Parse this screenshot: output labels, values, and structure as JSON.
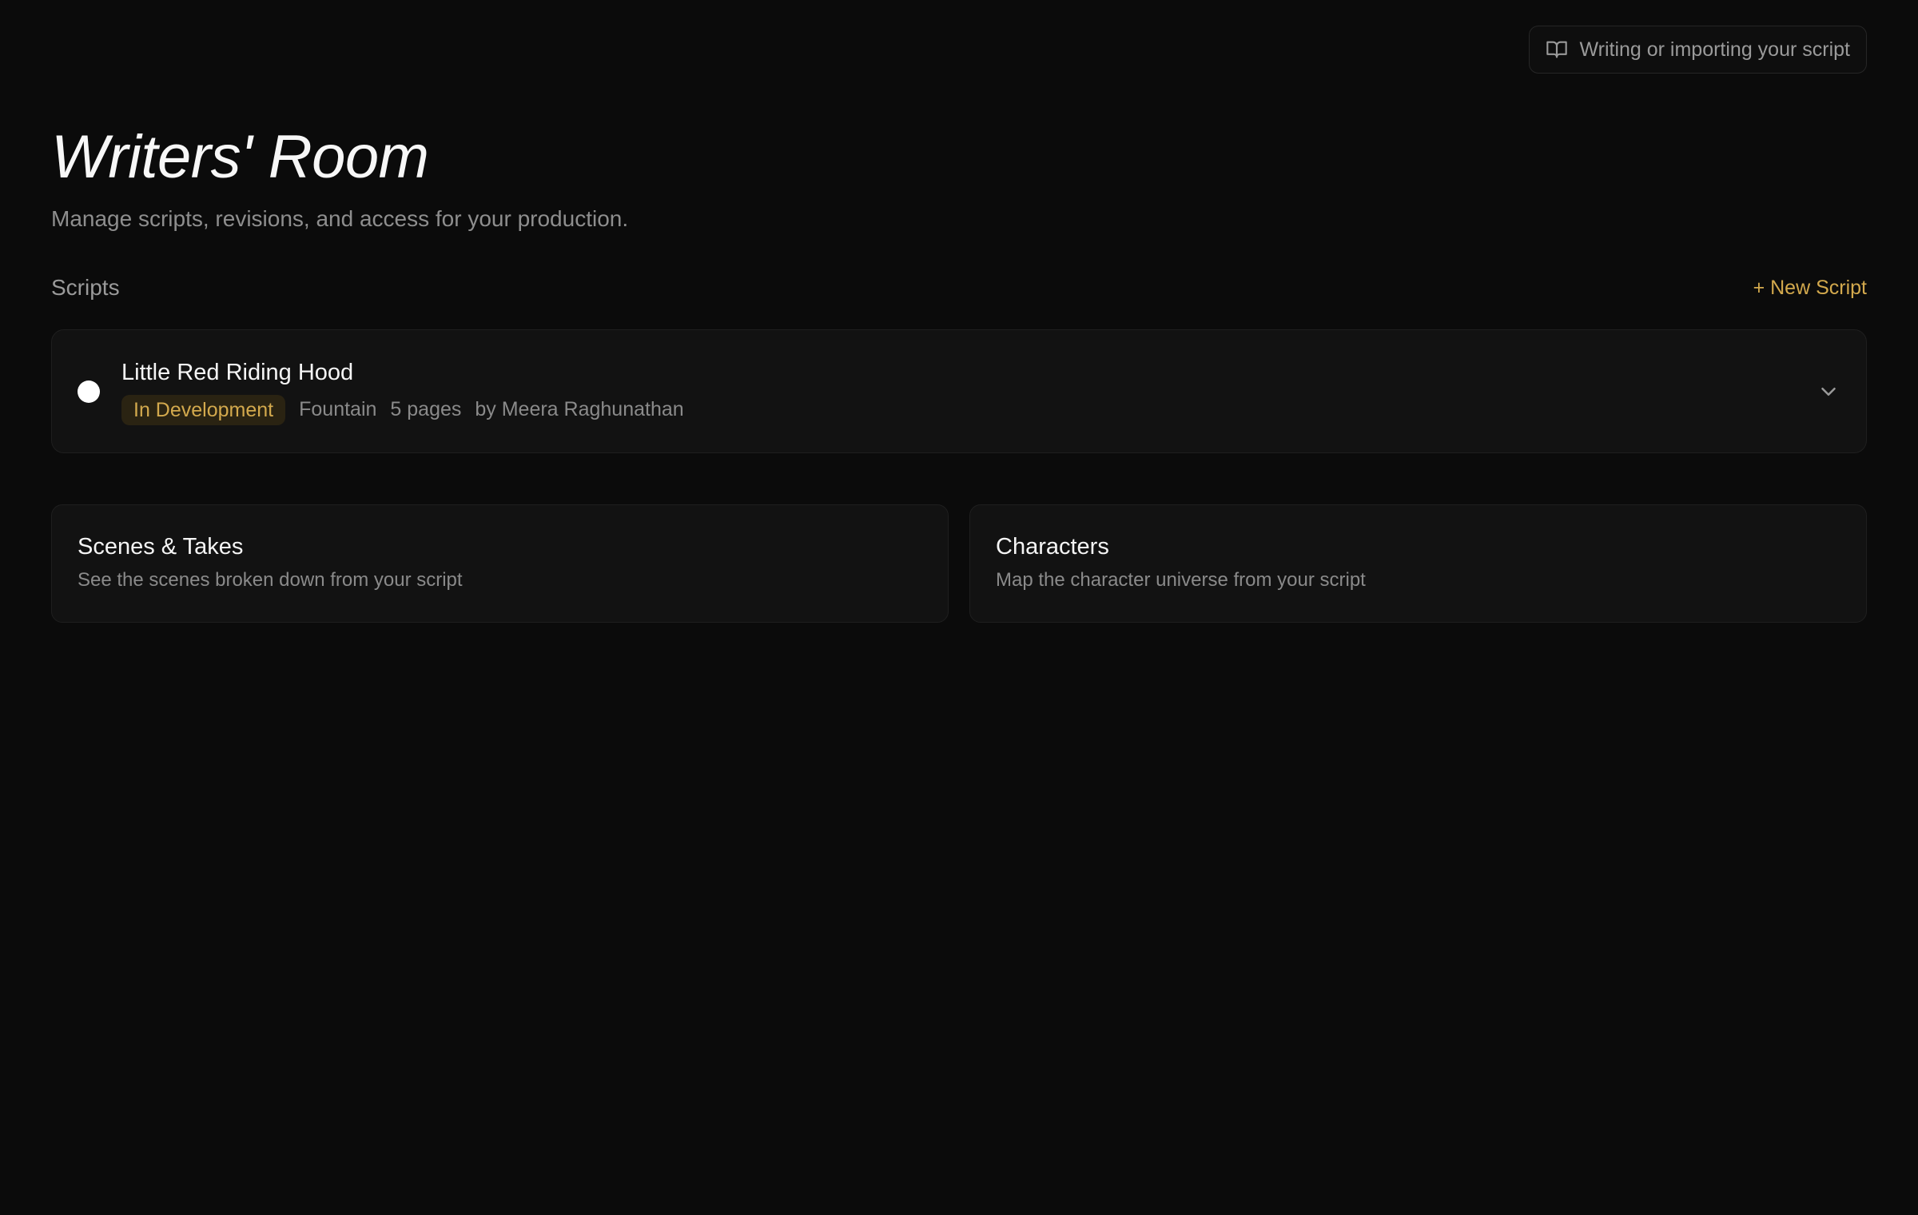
{
  "help_link": {
    "label": "Writing or importing your script",
    "icon": "book-open-icon"
  },
  "header": {
    "title": "Writers' Room",
    "subtitle": "Manage scripts, revisions, and access for your production."
  },
  "scripts_section": {
    "title": "Scripts",
    "new_button": "+ New Script",
    "items": [
      {
        "title": "Little Red Riding Hood",
        "status": "In Development",
        "format": "Fountain",
        "pages": "5 pages",
        "author": "by Meera Raghunathan",
        "expand_icon": "chevron-down-icon"
      }
    ]
  },
  "tiles": [
    {
      "title": "Scenes & Takes",
      "description": "See the scenes broken down from your script"
    },
    {
      "title": "Characters",
      "description": "Map the character universe from your script"
    }
  ],
  "colors": {
    "background": "#0b0b0b",
    "card": "#121212",
    "accent": "#d3a94d",
    "badge_bg": "#2a2312",
    "muted_text": "#8a8a8a"
  }
}
